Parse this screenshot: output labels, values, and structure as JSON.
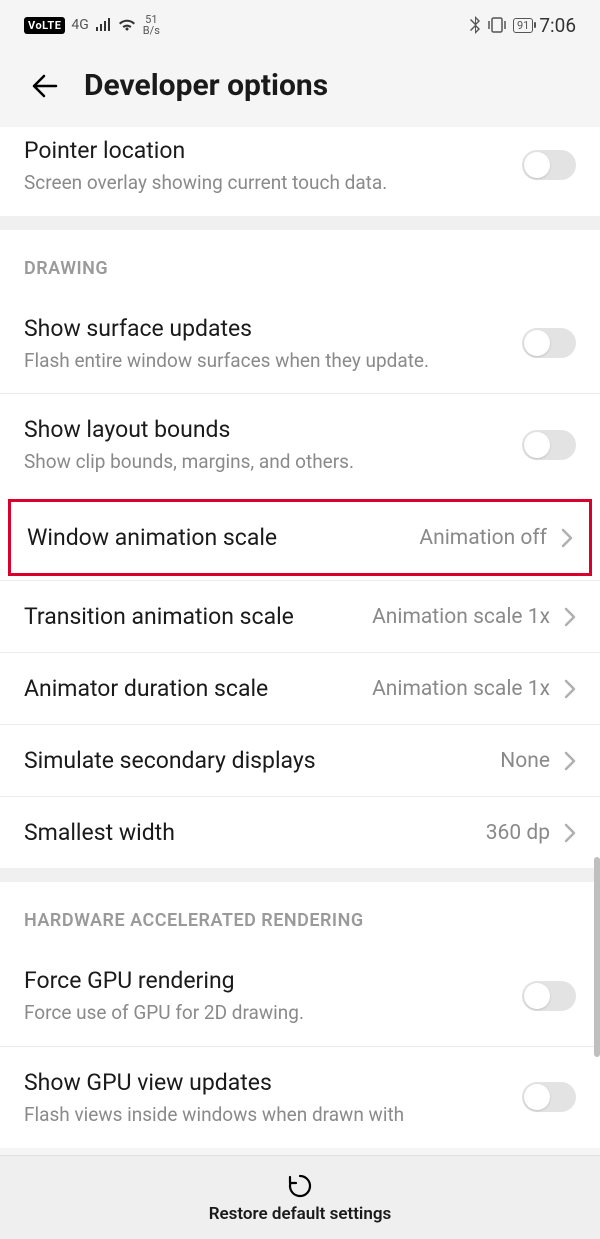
{
  "status": {
    "volte": "VoLTE",
    "net": "4G",
    "speed_top": "51",
    "speed_bot": "B/s",
    "battery": "91",
    "time": "7:06"
  },
  "header": {
    "title": "Developer options"
  },
  "pointer": {
    "title": "Pointer location",
    "desc": "Screen overlay showing current touch data."
  },
  "drawing": {
    "header": "DRAWING",
    "surface": {
      "title": "Show surface updates",
      "desc": "Flash entire window surfaces when they update."
    },
    "layout": {
      "title": "Show layout bounds",
      "desc": "Show clip bounds, margins, and others."
    },
    "winanim": {
      "title": "Window animation scale",
      "value": "Animation off"
    },
    "transanim": {
      "title": "Transition animation scale",
      "value": "Animation scale 1x"
    },
    "duranim": {
      "title": "Animator duration scale",
      "value": "Animation scale 1x"
    },
    "simdisplay": {
      "title": "Simulate secondary displays",
      "value": "None"
    },
    "smallestwidth": {
      "title": "Smallest width",
      "value": "360 dp"
    }
  },
  "hw": {
    "header": "HARDWARE ACCELERATED RENDERING",
    "forcegpu": {
      "title": "Force GPU rendering",
      "desc": "Force use of GPU for 2D drawing."
    },
    "gpuview": {
      "title": "Show GPU view updates",
      "desc": "Flash views inside windows when drawn with"
    }
  },
  "footer": {
    "restore": "Restore default settings"
  }
}
